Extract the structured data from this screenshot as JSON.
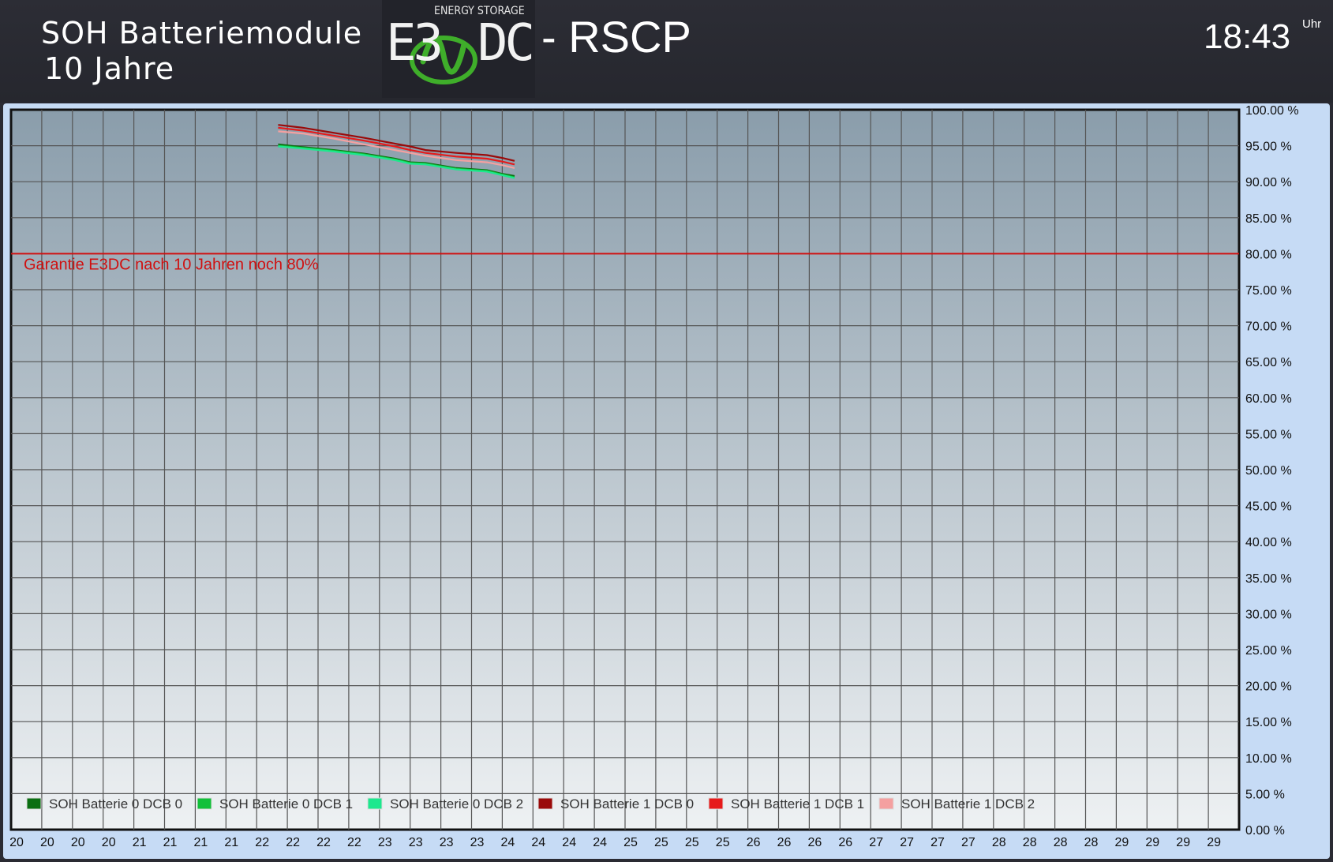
{
  "header": {
    "title_line1": "SOH Batteriemodule",
    "title_line2": "10 Jahre",
    "logo_tagline": "ENERGY STORAGE",
    "logo_left": "E3",
    "logo_right": "DC",
    "subtitle": "- RSCP",
    "clock": "18:43",
    "clock_unit": "Uhr"
  },
  "colors": {
    "background": "#2a2b33",
    "panel": "#c6dbf5",
    "plot_top": "#8a9dab",
    "plot_bottom": "#eef1f3",
    "guarantee_line": "#d01010",
    "logo_green": "#3fae2a"
  },
  "chart_data": {
    "type": "line",
    "x_tick_labels": [
      "20",
      "20",
      "20",
      "20",
      "21",
      "21",
      "21",
      "21",
      "22",
      "22",
      "22",
      "22",
      "23",
      "23",
      "23",
      "23",
      "24",
      "24",
      "24",
      "24",
      "25",
      "25",
      "25",
      "25",
      "26",
      "26",
      "26",
      "26",
      "27",
      "27",
      "27",
      "27",
      "28",
      "28",
      "28",
      "28",
      "29",
      "29",
      "29",
      "29"
    ],
    "y_tick_labels": [
      "100.00 %",
      "95.00 %",
      "90.00 %",
      "85.00 %",
      "80.00 %",
      "75.00 %",
      "70.00 %",
      "65.00 %",
      "60.00 %",
      "55.00 %",
      "50.00 %",
      "45.00 %",
      "40.00 %",
      "35.00 %",
      "30.00 %",
      "25.00 %",
      "20.00 %",
      "15.00 %",
      "10.00 %",
      "5.00 %",
      "0.00 %"
    ],
    "ylim": [
      0,
      100
    ],
    "grid": true,
    "x_index_range": [
      0,
      40
    ],
    "annotation": {
      "text": "Garantie E3DC nach 10 Jahren noch 80%",
      "y": 80,
      "color": "#d01010"
    },
    "legend_position": "bottom-left",
    "series": [
      {
        "name": "SOH Batterie 0 DCB 0",
        "color": "#0b6e12",
        "x": [
          8.7,
          9.5,
          10.5,
          11.5,
          12.5,
          13.0,
          13.5,
          14.5,
          15.5,
          16.0,
          16.4
        ],
        "y": [
          95.2,
          94.8,
          94.4,
          93.9,
          93.2,
          92.7,
          92.6,
          91.9,
          91.6,
          91.1,
          90.8
        ]
      },
      {
        "name": "SOH Batterie 0 DCB 1",
        "color": "#12c03a",
        "x": [
          8.7,
          9.5,
          10.5,
          11.5,
          12.5,
          13.0,
          13.5,
          14.5,
          15.5,
          16.0,
          16.4
        ],
        "y": [
          95.0,
          94.7,
          94.3,
          93.8,
          93.1,
          92.6,
          92.5,
          91.8,
          91.5,
          91.0,
          90.6
        ]
      },
      {
        "name": "SOH Batterie 0 DCB 2",
        "color": "#1de88e",
        "x": [
          8.7,
          9.5,
          10.5,
          11.5,
          12.5,
          13.0,
          13.5,
          14.5,
          15.5,
          16.0,
          16.4
        ],
        "y": [
          94.9,
          94.6,
          94.2,
          93.7,
          93.0,
          92.5,
          92.4,
          91.7,
          91.4,
          90.9,
          90.5
        ]
      },
      {
        "name": "SOH Batterie 1 DCB 0",
        "color": "#9a0a0a",
        "x": [
          8.7,
          9.5,
          10.5,
          11.5,
          12.5,
          13.0,
          13.5,
          14.5,
          15.5,
          16.0,
          16.4
        ],
        "y": [
          97.9,
          97.5,
          96.8,
          96.1,
          95.3,
          94.9,
          94.4,
          94.0,
          93.7,
          93.3,
          92.9
        ]
      },
      {
        "name": "SOH Batterie 1 DCB 1",
        "color": "#e61b1b",
        "x": [
          8.7,
          9.5,
          10.5,
          11.5,
          12.5,
          13.0,
          13.5,
          14.5,
          15.5,
          16.0,
          16.4
        ],
        "y": [
          97.5,
          97.1,
          96.4,
          95.7,
          94.9,
          94.4,
          94.0,
          93.5,
          93.2,
          92.8,
          92.4
        ]
      },
      {
        "name": "SOH Batterie 1 DCB 2",
        "color": "#f4a0a0",
        "x": [
          8.7,
          9.5,
          10.5,
          11.5,
          12.5,
          13.0,
          13.5,
          14.5,
          15.5,
          16.0,
          16.4
        ],
        "y": [
          97.0,
          96.7,
          96.0,
          95.2,
          94.4,
          94.0,
          93.6,
          93.0,
          92.7,
          92.3,
          91.9
        ]
      }
    ]
  }
}
